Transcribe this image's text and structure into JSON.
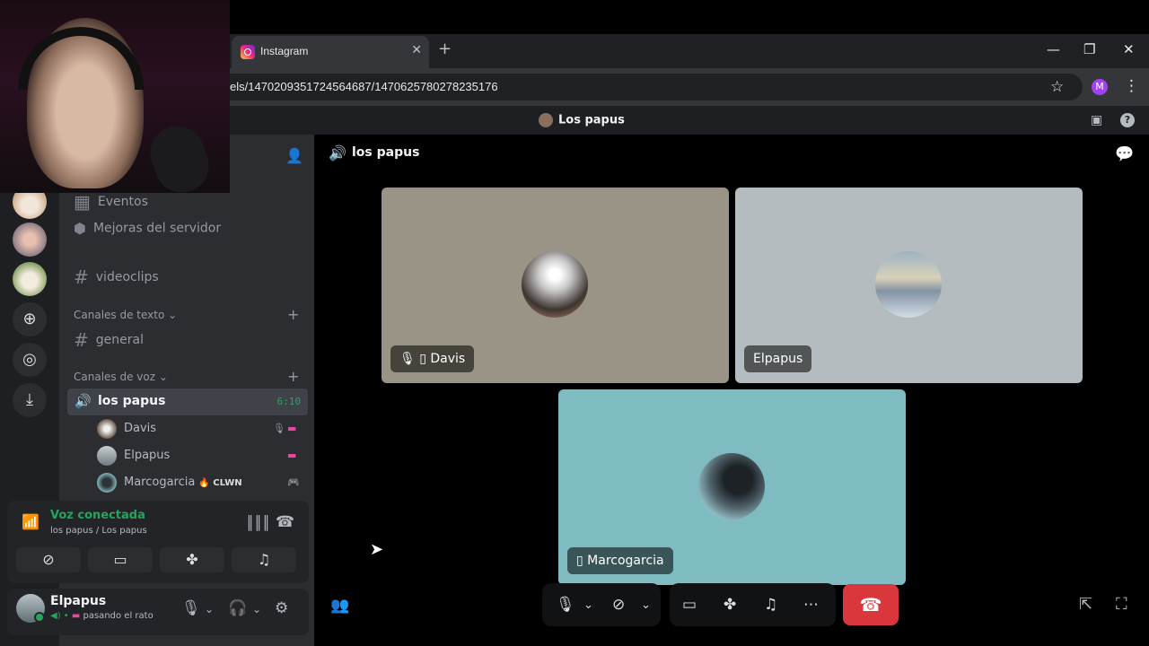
{
  "browser": {
    "tab_title": "Instagram",
    "tab_close": "✕",
    "new_tab": "+",
    "url": "els/1470209351724564687/1470625780278235176",
    "profile_initial": "M",
    "window_controls": [
      "—",
      "❐",
      "✕"
    ]
  },
  "discord": {
    "titlebar_title": "Los papus",
    "channels": {
      "eventos": "Eventos",
      "mejoras": "Mejoras del servidor",
      "videoclips": "videoclips",
      "text_category": "Canales de texto ⌄",
      "general": "general",
      "voice_category": "Canales de voz ⌄",
      "voice_channel": "los papus",
      "voice_timer": "6:10"
    },
    "voice_users": [
      {
        "name": "Davis",
        "tag": ""
      },
      {
        "name": "Elpapus",
        "tag": ""
      },
      {
        "name": "Marcogarcia",
        "tag": "🔥 CLWN"
      }
    ],
    "voice_panel": {
      "title": "Voz conectada",
      "subtitle": "los papus / Los papus"
    },
    "user_panel": {
      "name": "Elpapus",
      "status": "pasando el rato"
    },
    "main": {
      "channel_title": "los papus",
      "tiles": [
        {
          "label": "Davis"
        },
        {
          "label": "Elpapus"
        },
        {
          "label": "Marcogarcia"
        }
      ]
    }
  },
  "colors": {
    "accent_green": "#23a55a",
    "hangup_red": "#da373c",
    "tile_davis": "#9a9486",
    "tile_elpapus": "#b4bcbf",
    "tile_marco": "#7fbcc2"
  }
}
